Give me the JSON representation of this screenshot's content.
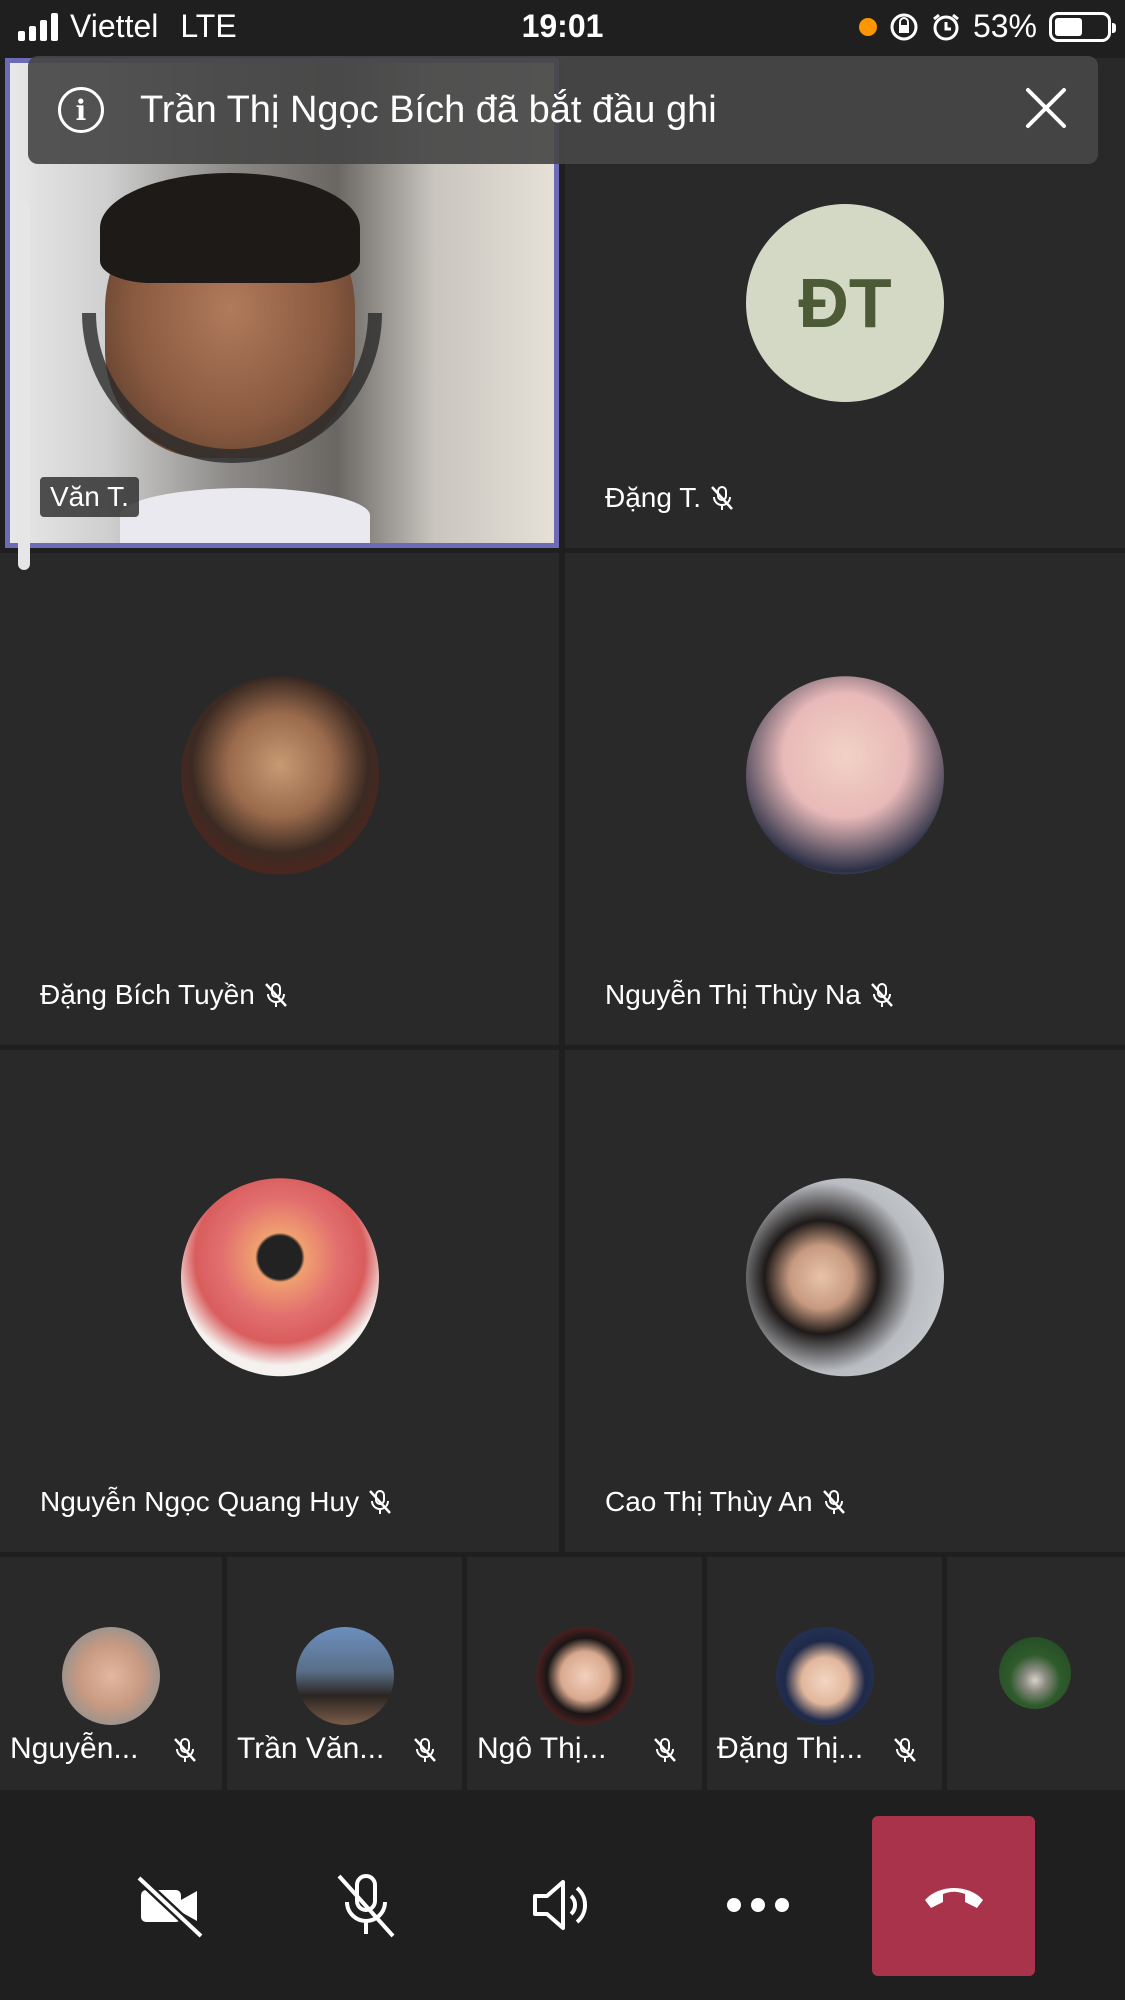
{
  "status_bar": {
    "carrier": "Viettel",
    "network": "LTE",
    "time": "19:01",
    "battery": "53%"
  },
  "banner": {
    "info_glyph": "i",
    "message": "Trần Thị Ngọc Bích đã bắt đầu ghi"
  },
  "participants": {
    "video": {
      "name": "Văn T."
    },
    "p1": {
      "name": "Đặng T.",
      "initials": "ĐT"
    },
    "p2": {
      "name": "Đặng Bích Tuyền"
    },
    "p3": {
      "name": "Nguyễn Thị Thùy Na"
    },
    "p4": {
      "name": "Nguyễn Ngọc Quang Huy"
    },
    "p5": {
      "name": "Cao Thị Thùy An"
    }
  },
  "strip": [
    {
      "name": "Nguyễn..."
    },
    {
      "name": "Trần Văn..."
    },
    {
      "name": "Ngô Thị..."
    },
    {
      "name": "Đặng Thị..."
    }
  ],
  "colors": {
    "background": "#1f1f1f",
    "tile": "#2a292a",
    "active_border": "#6b6cb5",
    "hangup": "#a8334a",
    "initials_bg": "#d4d9c6"
  }
}
